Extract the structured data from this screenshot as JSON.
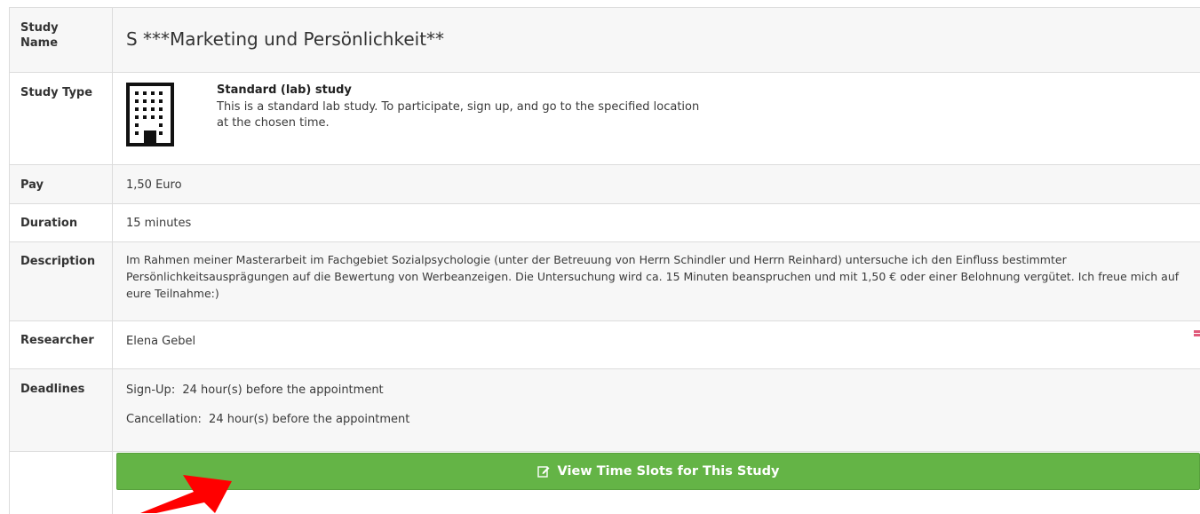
{
  "study_name": {
    "label": "Study Name",
    "value": "S ***Marketing und Persönlichkeit**"
  },
  "study_type": {
    "label": "Study Type",
    "icon": "building-icon",
    "title": "Standard (lab) study",
    "description": "This is a standard lab study. To participate, sign up, and go to the specified location at the chosen time."
  },
  "pay": {
    "label": "Pay",
    "value": "1,50 Euro"
  },
  "duration": {
    "label": "Duration",
    "value": "15 minutes"
  },
  "description": {
    "label": "Description",
    "value": "Im Rahmen meiner Masterarbeit im Fachgebiet Sozialpsychologie (unter der Betreuung von Herrn Schindler und Herrn Reinhard) untersuche ich den Einfluss bestimmter Persönlichkeitsausprägungen auf die Bewertung von Werbeanzeigen. Die Untersuchung wird ca. 15 Minuten beanspruchen und mit 1,50 € oder einer Belohnung vergütet. Ich freue mich auf eure Teilnahme:)"
  },
  "researcher": {
    "label": "Researcher",
    "value": "Elena Gebel"
  },
  "deadlines": {
    "label": "Deadlines",
    "signup_key": "Sign-Up:",
    "signup_value": "24 hour(s) before the appointment",
    "cancellation_key": "Cancellation:",
    "cancellation_value": "24 hour(s) before the appointment"
  },
  "action": {
    "button_label": "View Time Slots for This Study",
    "button_icon": "edit-icon"
  },
  "colors": {
    "button_green": "#64b446",
    "annotation_red": "#ff0000",
    "row_alt": "#f7f7f7",
    "border": "#dcdcdc"
  }
}
